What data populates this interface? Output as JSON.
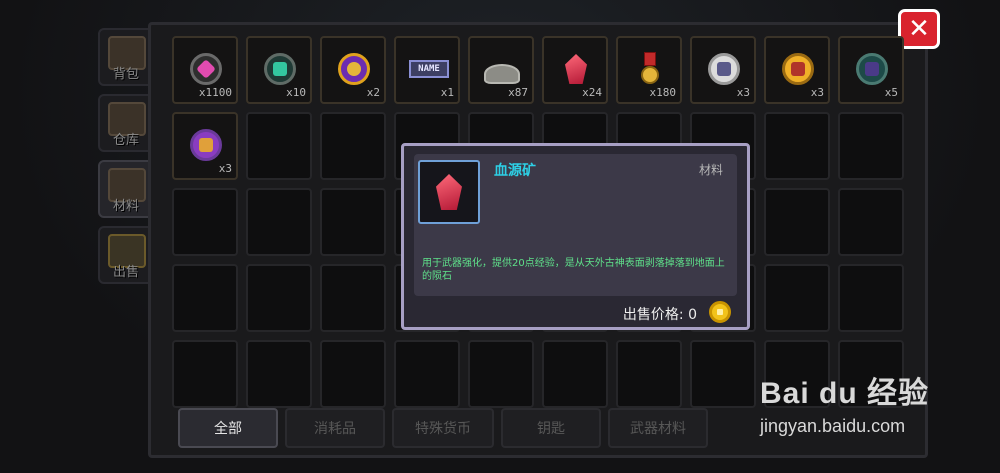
{
  "side_tabs": [
    {
      "label": "背包",
      "active": false
    },
    {
      "label": "仓库",
      "active": false
    },
    {
      "label": "材料",
      "active": true
    },
    {
      "label": "出售",
      "active": false
    }
  ],
  "close_label": "✕",
  "items": [
    {
      "icon": "pink-gem-icon",
      "qty": "x1100"
    },
    {
      "icon": "green-orb-icon",
      "qty": "x10"
    },
    {
      "icon": "purple-coin-icon",
      "qty": "x2"
    },
    {
      "icon": "name-tag-icon",
      "name": "NAME",
      "qty": "x1"
    },
    {
      "icon": "ore-rock-icon",
      "qty": "x87"
    },
    {
      "icon": "blood-crystal-icon",
      "qty": "x24"
    },
    {
      "icon": "medal-icon",
      "qty": "x180"
    },
    {
      "icon": "silver-chest-orb-icon",
      "qty": "x3"
    },
    {
      "icon": "gold-chest-orb-icon",
      "qty": "x3"
    },
    {
      "icon": "blue-chest-orb-icon",
      "qty": "x5"
    },
    {
      "icon": "purple-chest-orb-icon",
      "qty": "x3"
    }
  ],
  "filters": [
    {
      "label": "全部",
      "active": true
    },
    {
      "label": "消耗品",
      "active": false
    },
    {
      "label": "特殊货币",
      "active": false
    },
    {
      "label": "钥匙",
      "active": false
    },
    {
      "label": "武器材料",
      "active": false
    }
  ],
  "detail": {
    "name": "血源矿",
    "category": "材料",
    "description": "用于武器强化，提供20点经验，是从天外古神表面剥落掉落到地面上的陨石",
    "price_label": "出售价格: 0"
  },
  "watermark": {
    "logo": "Bai du 经验",
    "url": "jingyan.baidu.com"
  },
  "colors": {
    "accent_title": "#2dd0e6",
    "description": "#5fe08a",
    "close": "#d9232e",
    "popup_border": "#a79fc4"
  }
}
